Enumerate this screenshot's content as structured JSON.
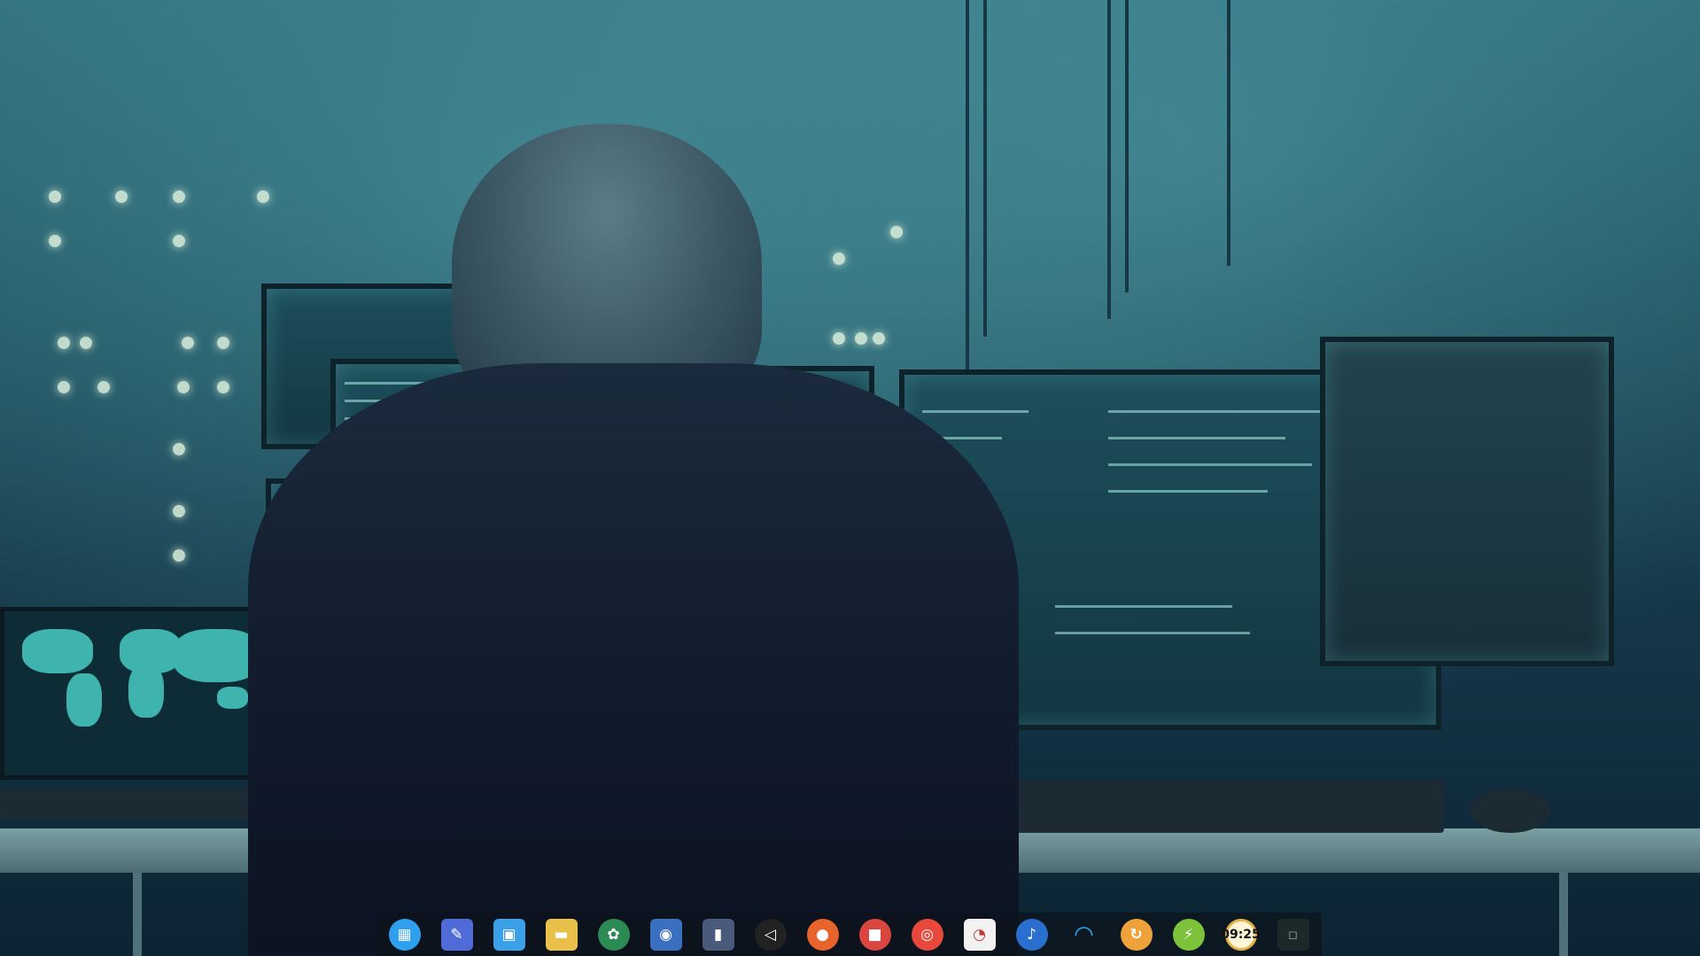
{
  "desktop": {
    "wallpaper": "hooded-person-server-room"
  },
  "dock": {
    "items": [
      {
        "name": "launcher",
        "icon": "launcher-icon",
        "color": "#2f9ff0"
      },
      {
        "name": "editor",
        "icon": "pen-editor-icon",
        "color": "#4f6bd8"
      },
      {
        "name": "multitask-view",
        "icon": "multitask-icon",
        "color": "#3aa0e8"
      },
      {
        "name": "file-manager",
        "icon": "folder-icon",
        "color": "#e8c04a"
      },
      {
        "name": "system-tools",
        "icon": "wrench-icon",
        "color": "#2c8a55"
      },
      {
        "name": "screenshot",
        "icon": "camera-icon",
        "color": "#3b6fc0"
      },
      {
        "name": "video-editor",
        "icon": "film-icon",
        "color": "#4a5a7a"
      },
      {
        "name": "unity",
        "icon": "unity-icon",
        "color": "#222222"
      },
      {
        "name": "firefox",
        "icon": "firefox-icon",
        "color": "#e8642c"
      },
      {
        "name": "screen-recorder",
        "icon": "video-camera-icon",
        "color": "#d9463f"
      },
      {
        "name": "chrome",
        "icon": "chrome-icon",
        "color": "#e8483b"
      },
      {
        "name": "document-viewer",
        "icon": "document-eye-icon",
        "color": "#f2f2f2"
      },
      {
        "name": "music-player",
        "icon": "music-icon",
        "color": "#2a6fd0"
      },
      {
        "name": "network",
        "icon": "wifi-icon",
        "color": "#2fa4f0"
      },
      {
        "name": "cloud-sync",
        "icon": "sync-icon",
        "color": "#f0a23a"
      },
      {
        "name": "power-manager",
        "icon": "lightning-icon",
        "color": "#7cc23a"
      },
      {
        "name": "clock",
        "icon": "clock-icon",
        "color": "#e4b34a",
        "text": "09:25"
      },
      {
        "name": "trash",
        "icon": "trash-icon",
        "color": "#2b3a2e"
      }
    ]
  }
}
